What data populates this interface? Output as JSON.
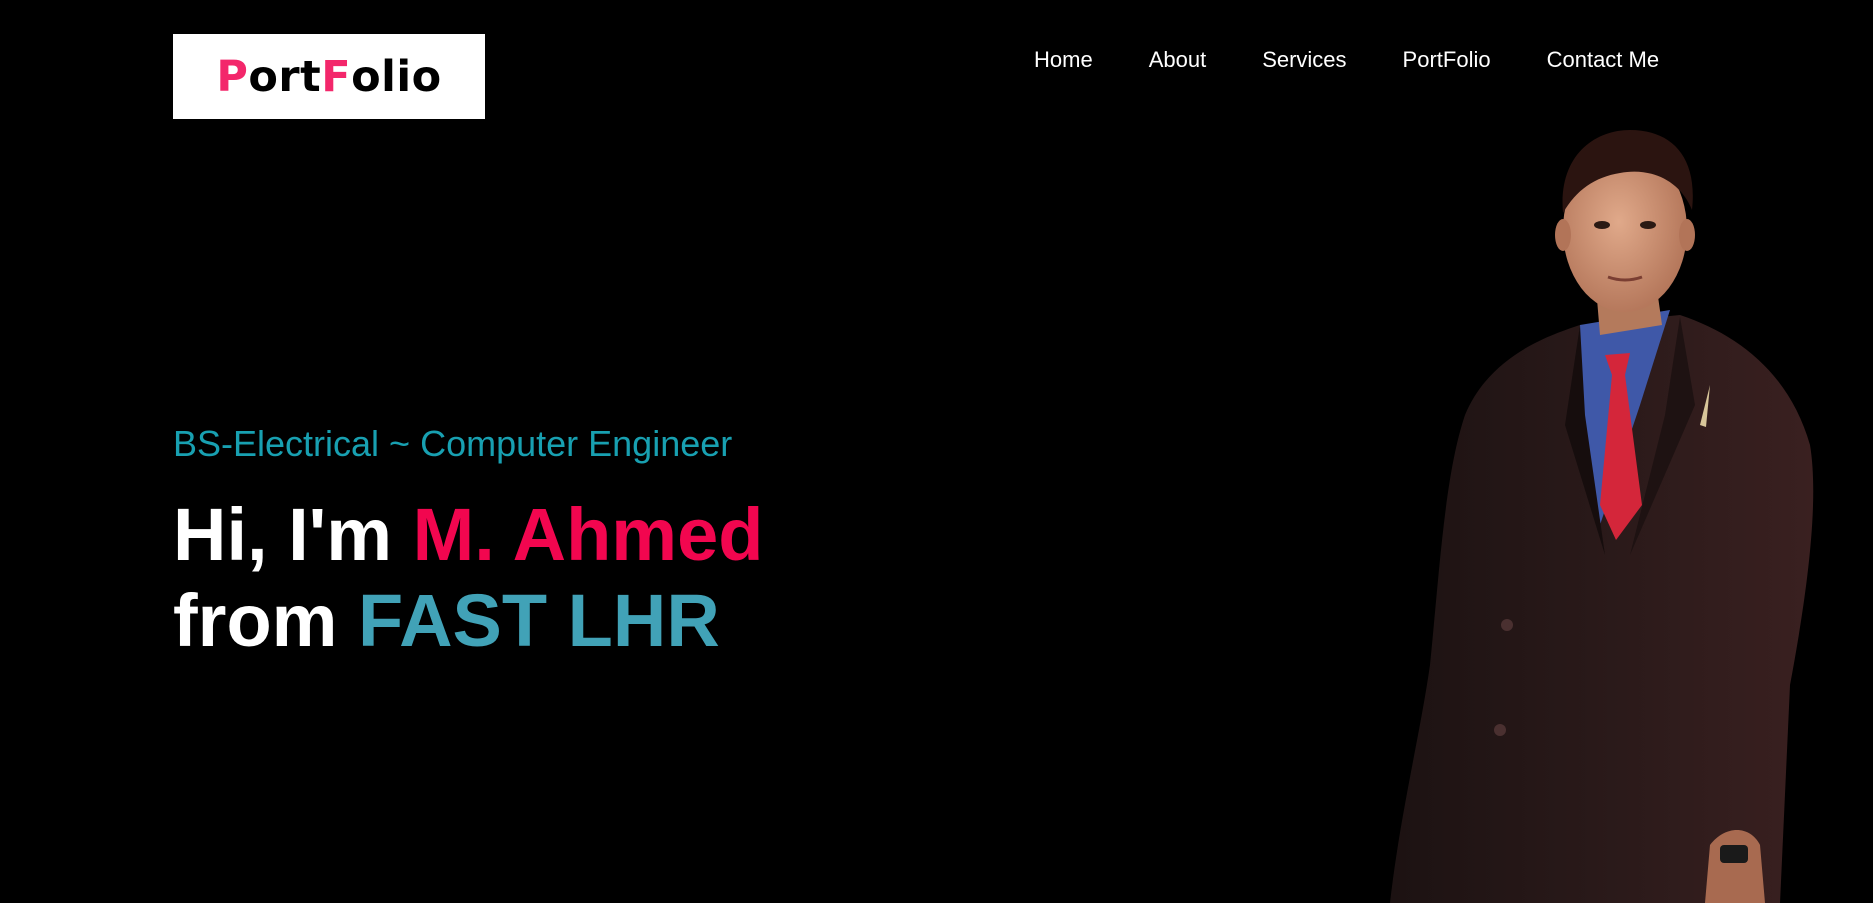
{
  "logo": {
    "part1_accent": "P",
    "part2": "ort",
    "part3_accent": "F",
    "part4": "olio"
  },
  "nav": {
    "items": [
      "Home",
      "About",
      "Services",
      "PortFolio",
      "Contact Me"
    ]
  },
  "hero": {
    "subtitle": "BS-Electrical ~ Computer Engineer",
    "line1_prefix": "Hi, I'm ",
    "name": "M. Ahmed",
    "line2_prefix": "from ",
    "school": "FAST LHR"
  },
  "colors": {
    "background": "#000000",
    "logo_accent": "#f3276b",
    "subtitle": "#18a0b1",
    "name": "#f2064f",
    "school": "#41a2b7"
  }
}
